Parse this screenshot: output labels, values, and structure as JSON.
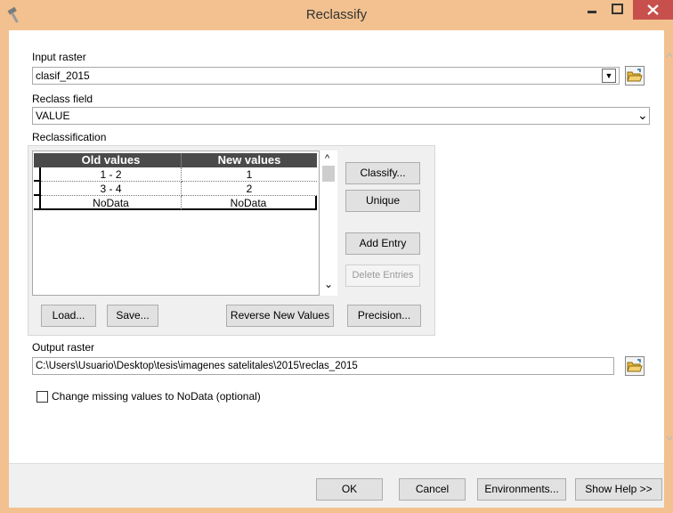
{
  "window": {
    "title": "Reclassify",
    "minimize": "–",
    "close": "✕"
  },
  "input_raster": {
    "label": "Input raster",
    "value": "clasif_2015",
    "dropdown_glyph": "▼"
  },
  "reclass_field": {
    "label": "Reclass field",
    "value": "VALUE",
    "dropdown_glyph": "⌄"
  },
  "reclassification": {
    "label": "Reclassification",
    "columns": [
      "Old values",
      "New values"
    ],
    "rows": [
      {
        "old": "1 - 2",
        "new": "1"
      },
      {
        "old": "3 - 4",
        "new": "2"
      },
      {
        "old": "NoData",
        "new": "NoData"
      }
    ],
    "scroll_up": "^",
    "scroll_down": "⌄",
    "buttons": {
      "classify": "Classify...",
      "unique": "Unique",
      "add_entry": "Add Entry",
      "delete_entries": "Delete Entries",
      "load": "Load...",
      "save": "Save...",
      "reverse": "Reverse New Values",
      "precision": "Precision..."
    }
  },
  "output_raster": {
    "label": "Output raster",
    "value": "C:\\Users\\Usuario\\Desktop\\tesis\\imagenes satelitales\\2015\\reclas_2015"
  },
  "missing_values": {
    "label": "Change missing values to NoData (optional)",
    "checked": false
  },
  "footer": {
    "ok": "OK",
    "cancel": "Cancel",
    "environments": "Environments...",
    "show_help": "Show Help >>"
  },
  "colors": {
    "titlebar": "#f2c18f",
    "close_button": "#c7504c",
    "grid_header": "#4a4a4a"
  }
}
